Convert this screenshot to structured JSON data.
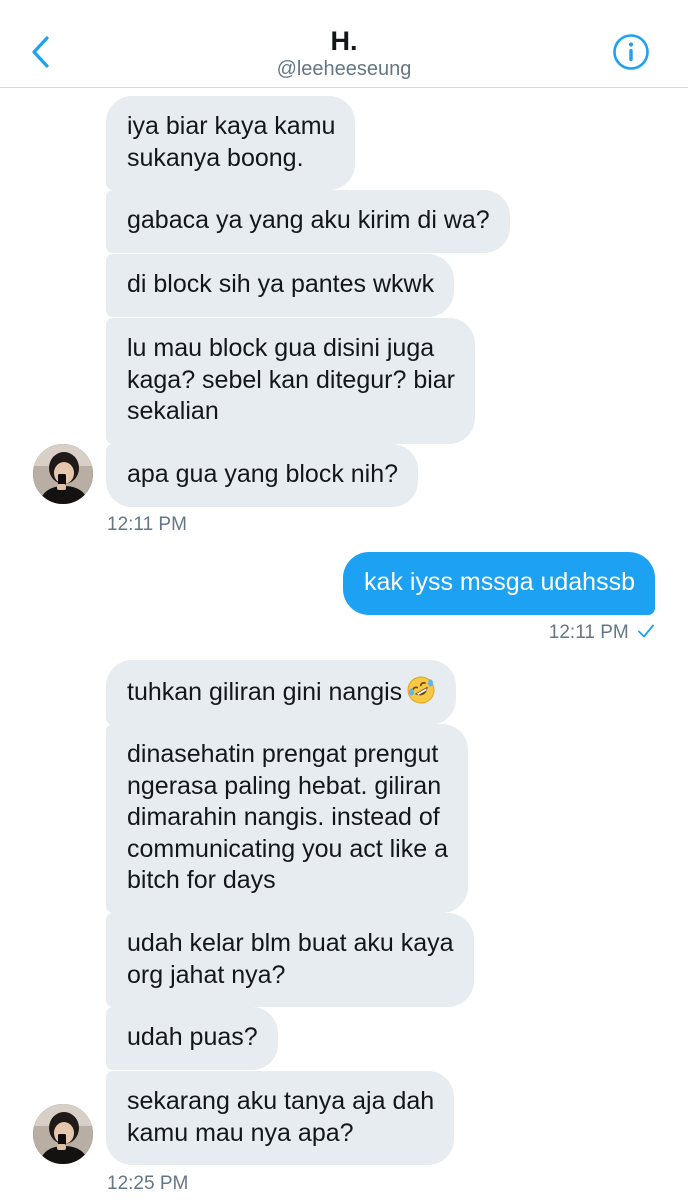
{
  "header": {
    "title": "H.",
    "handle": "@leeheeseung"
  },
  "colors": {
    "accent": "#1da1f2",
    "incoming_bubble": "#e6ecf0",
    "secondary_text": "#657786"
  },
  "icons": {
    "back": "chevron-left-icon",
    "info": "info-circle-icon",
    "read": "checkmark-icon",
    "emoji": "rolling-on-floor-laughing-emoji"
  },
  "messages": {
    "m1": [
      "iya biar kaya kamu",
      "sukanya boong."
    ],
    "m2": [
      "gabaca ya yang aku kirim di wa?"
    ],
    "m3": [
      "di block sih ya pantes wkwk"
    ],
    "m4": [
      "lu mau block gua disini juga",
      "kaga? sebel kan ditegur? biar",
      "sekalian"
    ],
    "m5": [
      "apa gua yang block nih?"
    ],
    "time1": "12:11 PM",
    "m6": [
      "kak iyss mssga udahssb"
    ],
    "time2": "12:11 PM",
    "m7": [
      "tuhkan giliran gini nangis"
    ],
    "m8": [
      "dinasehatin prengat prengut",
      "ngerasa paling hebat. giliran",
      "dimarahin nangis. instead of",
      "communicating you act like a",
      "bitch for days"
    ],
    "m9": [
      "udah kelar blm buat aku kaya",
      "org jahat nya?"
    ],
    "m10": [
      "udah puas?"
    ],
    "m11": [
      "sekarang aku tanya aja dah",
      "kamu mau nya apa?"
    ],
    "time3": "12:25 PM"
  }
}
